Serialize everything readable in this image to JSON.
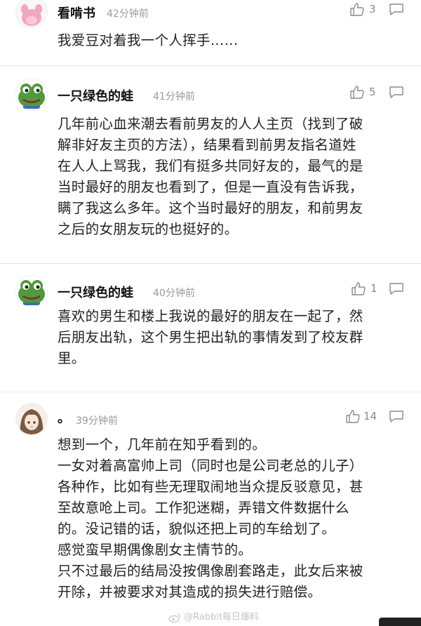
{
  "comments": [
    {
      "avatar_icon": "pink-panther-avatar-icon",
      "username": "看啃书",
      "time": "42分钟前",
      "likes": "3",
      "text": "我爱豆对着我一个人挥手……"
    },
    {
      "avatar_icon": "green-frog-avatar-icon",
      "username": "一只绿色的蛙",
      "time": "41分钟前",
      "likes": "5",
      "text": "几年前心血来潮去看前男友的人人主页（找到了破\n解非好友主页的方法），结果看到前男友指名道姓\n在人人上骂我，我们有挺多共同好友的，最气的是\n当时最好的朋友也看到了，但是一直没有告诉我，\n瞒了我这么多年。这个当时最好的朋友，和前男友\n之后的女朋友玩的也挺好的。"
    },
    {
      "avatar_icon": "green-frog-avatar-icon",
      "username": "一只绿色的蛙",
      "time": "40分钟前",
      "likes": "1",
      "text": "喜欢的男生和楼上我说的最好的朋友在一起了，然\n后朋友出轨，这个男生把出轨的事情发到了校友群\n里。"
    },
    {
      "avatar_icon": "anime-girl-avatar-icon",
      "username": "。",
      "time": "39分钟前",
      "likes": "14",
      "text": "想到一个，几年前在知乎看到的。\n一女对着高富帅上司（同时也是公司老总的儿子）\n各种作，比如有些无理取闹地当众提反驳意见，甚\n至故意呛上司。工作犯迷糊，弄错文件数据什么\n的。没记错的话，貌似还把上司的车给划了。\n感觉蛮早期偶像剧女主情节的。\n只不过最后的结局没按偶像剧套路走，此女后来被\n开除，并被要求对其造成的损失进行赔偿。"
    }
  ],
  "watermark": "@Rabbit每日爆料",
  "colors": {
    "frog_green": "#4f9a3a",
    "muted_text": "#9a9a9a"
  }
}
